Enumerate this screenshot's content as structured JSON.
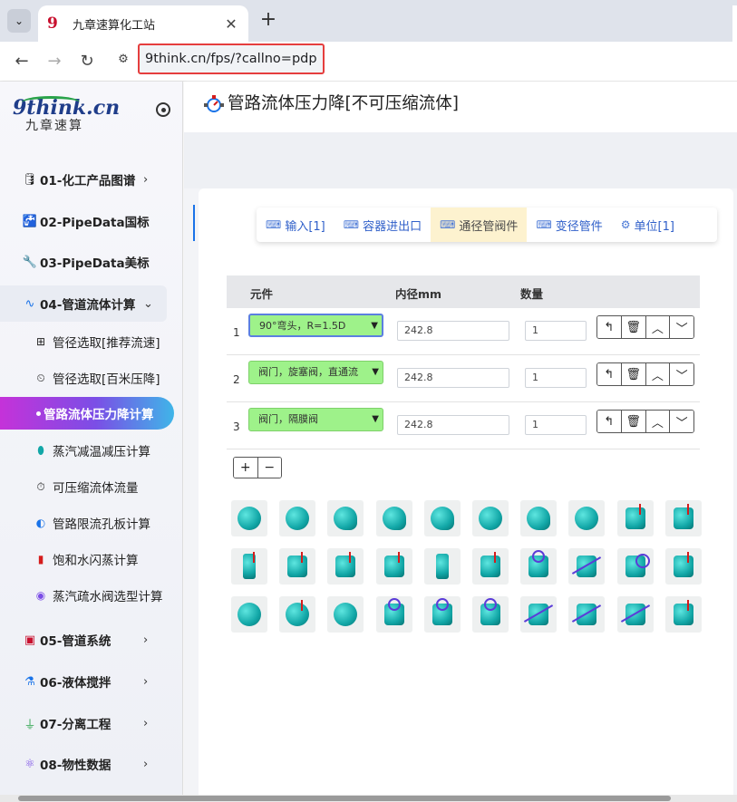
{
  "browser": {
    "tab_title": "九章速算化工站",
    "favicon_glyph": "9",
    "url": "9think.cn/fps/?callno=pdp"
  },
  "sidebar": {
    "logo_main": "9think.cn",
    "logo_sub": "九章速算",
    "menu": [
      {
        "label": "01-化工产品图谱",
        "icon": "barrel-icon"
      },
      {
        "label": "02-PipeData国标",
        "icon": "tap-icon"
      },
      {
        "label": "03-PipeData美标",
        "icon": "pipe-valve-icon"
      },
      {
        "label": "04-管道流体计算",
        "icon": "wave-icon"
      }
    ],
    "sub": [
      {
        "label": "管径选取[推荐流速]",
        "icon": "pipe-select-icon"
      },
      {
        "label": "管径选取[百米压降]",
        "icon": "gauge-icon"
      },
      {
        "label": "管路流体压力降计算",
        "icon": "active-dot"
      },
      {
        "label": "蒸汽减温减压计算",
        "icon": "steam-icon"
      },
      {
        "label": "可压缩流体流量",
        "icon": "flow-meter-icon"
      },
      {
        "label": "管路限流孔板计算",
        "icon": "orifice-icon"
      },
      {
        "label": "饱和水闪蒸计算",
        "icon": "flash-icon"
      },
      {
        "label": "蒸汽疏水阀选型计算",
        "icon": "trap-icon"
      }
    ],
    "menu_lower": [
      {
        "label": "05-管道系统",
        "icon": "pipe-system-icon"
      },
      {
        "label": "06-液体搅拌",
        "icon": "mixer-icon"
      },
      {
        "label": "07-分离工程",
        "icon": "separation-icon"
      },
      {
        "label": "08-物性数据",
        "icon": "atom-icon"
      }
    ]
  },
  "page": {
    "title": "管路流体压力降[不可压缩流体]",
    "tabs": [
      {
        "label": "输入[1]"
      },
      {
        "label": "容器进出口"
      },
      {
        "label": "通径管阀件"
      },
      {
        "label": "变径管件"
      },
      {
        "label": "单位[1]"
      }
    ],
    "table": {
      "headers": [
        "元件",
        "内径mm",
        "数量"
      ],
      "rows": [
        {
          "n": "1",
          "element": "90°弯头，R=1.5D",
          "diameter": "242.8",
          "qty": "1"
        },
        {
          "n": "2",
          "element": "阀门，旋塞阀，直通流",
          "diameter": "242.8",
          "qty": "1"
        },
        {
          "n": "3",
          "element": "阀门，隔膜阀",
          "diameter": "242.8",
          "qty": "1"
        }
      ],
      "row_buttons": [
        "↰",
        "🗑",
        "︿",
        "﹀"
      ]
    },
    "add_label": "+",
    "remove_label": "−"
  },
  "colors": {
    "accent": "#2f5fc9",
    "active_tab_bg": "#fdf2cf",
    "select_bg": "#9ef28a",
    "highlight_box": "#e53e3e",
    "fitting": "#12a7a7"
  }
}
